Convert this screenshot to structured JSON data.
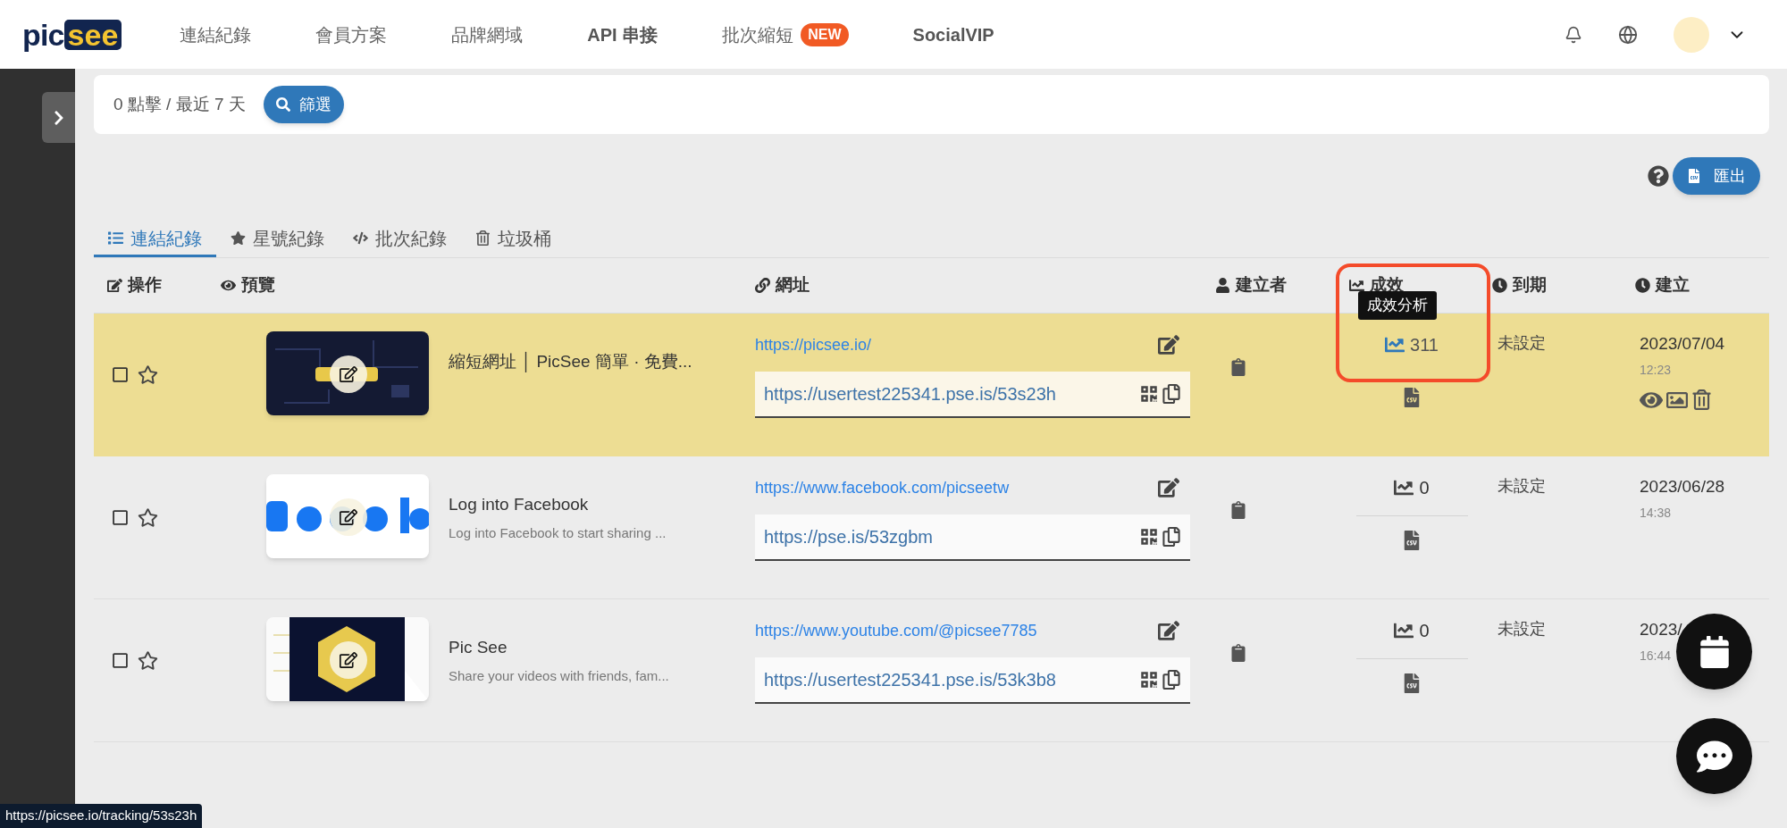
{
  "header": {
    "logo": [
      "pic",
      "see"
    ],
    "nav": [
      {
        "label": "連結紀錄"
      },
      {
        "label": "會員方案"
      },
      {
        "label": "品牌網域"
      },
      {
        "label": "API 串接",
        "strong": true
      },
      {
        "label": "批次縮短",
        "badge": "NEW"
      },
      {
        "label": "SocialVIP",
        "strong": true
      }
    ]
  },
  "filter_bar": {
    "summary": "0 點擊 / 最近 7 天",
    "button": "篩選"
  },
  "export_button": "匯出",
  "tabs": [
    {
      "label": "連結紀錄",
      "selected": true
    },
    {
      "label": "星號紀錄",
      "selected": false
    },
    {
      "label": "批次紀錄",
      "selected": false
    },
    {
      "label": "垃圾桶",
      "selected": false
    }
  ],
  "columns": [
    "操作",
    "預覽",
    "網址",
    "建立者",
    "成效",
    "到期",
    "建立"
  ],
  "rows": [
    {
      "hovered": true,
      "checked": false,
      "starred": false,
      "title": "縮短網址 │ PicSee 簡單 · 免費...",
      "url": "https://picsee.io/",
      "short_url": "https://usertest225341.pse.is/53s23h",
      "clicks": "311",
      "tooltip": "成效分析",
      "expiry": "未設定",
      "date": "2023/07/04",
      "time": "12:23"
    },
    {
      "hovered": false,
      "checked": false,
      "starred": false,
      "title": "Log into Facebook",
      "description": "Log into Facebook to start sharing ...",
      "url": "https://www.facebook.com/picseetw",
      "short_url": "https://pse.is/53zgbm",
      "clicks": "0",
      "expiry": "未設定",
      "date": "2023/06/28",
      "time": "14:38"
    },
    {
      "hovered": false,
      "checked": false,
      "starred": false,
      "title": "Pic See",
      "description": "Share your videos with friends, fam...",
      "url": "https://www.youtube.com/@picsee7785",
      "short_url": "https://usertest225341.pse.is/53k3b8",
      "clicks": "0",
      "expiry": "未設定",
      "date": "2023/",
      "time": "16:44"
    }
  ],
  "status_link": "https://picsee.io/tracking/53s23h"
}
